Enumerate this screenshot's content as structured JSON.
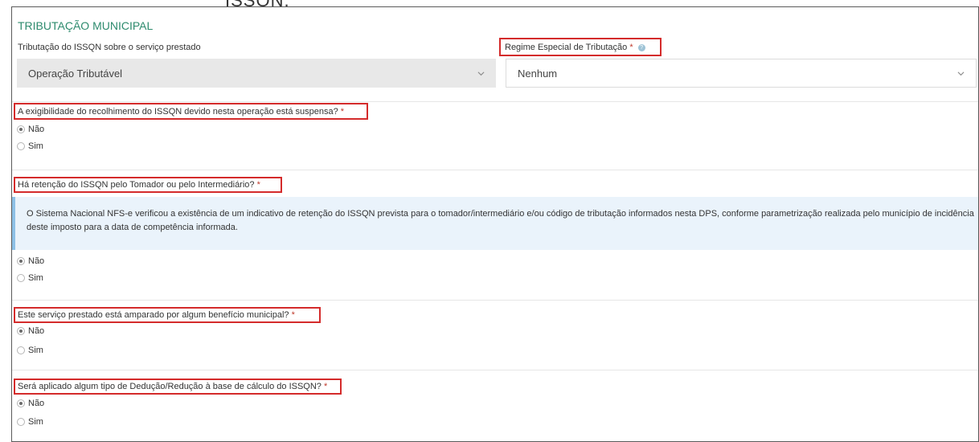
{
  "cropped_header": "ISSQN.",
  "section": {
    "title": "TRIBUTAÇÃO MUNICIPAL"
  },
  "tributacao": {
    "label": "Tributação do ISSQN sobre o serviço prestado",
    "value": "Operação Tributável"
  },
  "regime": {
    "label": "Regime Especial de Tributação",
    "required_mark": "*",
    "value": "Nenhum"
  },
  "questions": [
    {
      "label": "A exigibilidade do recolhimento do ISSQN devido nesta operação está suspensa?",
      "required_mark": "*",
      "options": [
        "Não",
        "Sim"
      ],
      "selected": "Não"
    },
    {
      "label": "Há retenção do ISSQN pelo Tomador ou pelo Intermediário?",
      "required_mark": "*",
      "info": "O Sistema Nacional NFS-e verificou a existência de um indicativo de retenção do ISSQN prevista para o tomador/intermediário e/ou código de tributação informados nesta DPS, conforme parametrização realizada pelo município de incidência deste imposto para a data de competência informada.",
      "options": [
        "Não",
        "Sim"
      ],
      "selected": "Não"
    },
    {
      "label": "Este serviço prestado está amparado por algum benefício municipal?",
      "required_mark": "*",
      "options": [
        "Não",
        "Sim"
      ],
      "selected": "Não"
    },
    {
      "label": "Será aplicado algum tipo de Dedução/Redução à base de cálculo do ISSQN?",
      "required_mark": "*",
      "options": [
        "Não",
        "Sim"
      ],
      "selected": "Não"
    }
  ],
  "colors": {
    "section_title": "#2e8b6e",
    "highlight_box": "#d42b2b",
    "required": "#c0392b",
    "info_background": "#eaf3fb"
  },
  "icons": [
    "chevron-down-icon",
    "help-icon"
  ]
}
